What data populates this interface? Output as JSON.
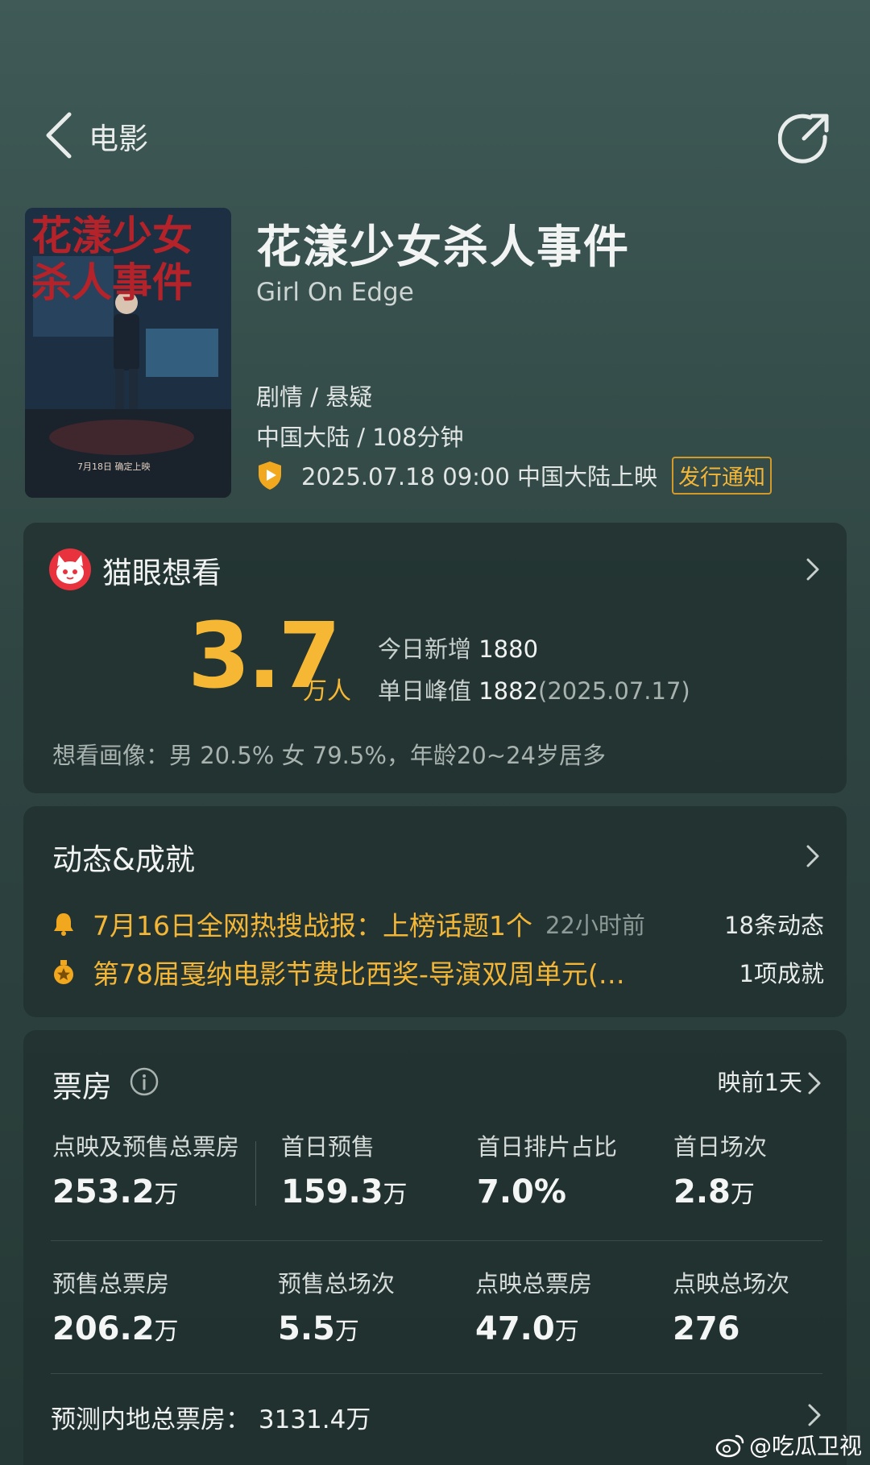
{
  "header": {
    "back_label": "电影"
  },
  "movie": {
    "title_cn": "花漾少女杀人事件",
    "title_en": "Girl On Edge",
    "genre": "剧情 / 悬疑",
    "region_duration": "中国大陆 / 108分钟",
    "release": "2025.07.18 09:00 中国大陆上映",
    "notice_button": "发行通知",
    "poster_title_line1": "花漾少女",
    "poster_title_line2": "杀人事件",
    "poster_date": "7月18日 确定上映"
  },
  "want_to_see": {
    "title": "猫眼想看",
    "big_value": "3.7",
    "big_unit": "万人",
    "today_label": "今日新增",
    "today_value": "1880",
    "peak_label": "单日峰值",
    "peak_value": "1882",
    "peak_date": "(2025.07.17)",
    "portrait": "想看画像：男 20.5%  女 79.5%，年龄20~24岁居多"
  },
  "dynamics": {
    "title": "动态&成就",
    "items": [
      {
        "text": "7月16日全网热搜战报：上榜话题1个",
        "time": "22小时前",
        "count": "18条动态",
        "icon": "bell-icon"
      },
      {
        "text": "第78届戛纳电影节费比西奖-导演双周单元(…",
        "time": "",
        "count": "1项成就",
        "icon": "medal-icon"
      }
    ]
  },
  "box_office": {
    "title": "票房",
    "days_label": "映前1天",
    "row1": [
      {
        "label": "点映及预售总票房",
        "value": "253.2",
        "unit": "万"
      },
      {
        "label": "首日预售",
        "value": "159.3",
        "unit": "万"
      },
      {
        "label": "首日排片占比",
        "value": "7.0%",
        "unit": ""
      },
      {
        "label": "首日场次",
        "value": "2.8",
        "unit": "万"
      }
    ],
    "row2": [
      {
        "label": "预售总票房",
        "value": "206.2",
        "unit": "万"
      },
      {
        "label": "预售总场次",
        "value": "5.5",
        "unit": "万"
      },
      {
        "label": "点映总票房",
        "value": "47.0",
        "unit": "万"
      },
      {
        "label": "点映总场次",
        "value": "276",
        "unit": ""
      }
    ],
    "forecast": "预测内地总票房：  3131.4万"
  },
  "watermark": "@吃瓜卫视",
  "colors": {
    "accent": "#f6b834",
    "background": "#2f4542",
    "card": "#20302e"
  }
}
